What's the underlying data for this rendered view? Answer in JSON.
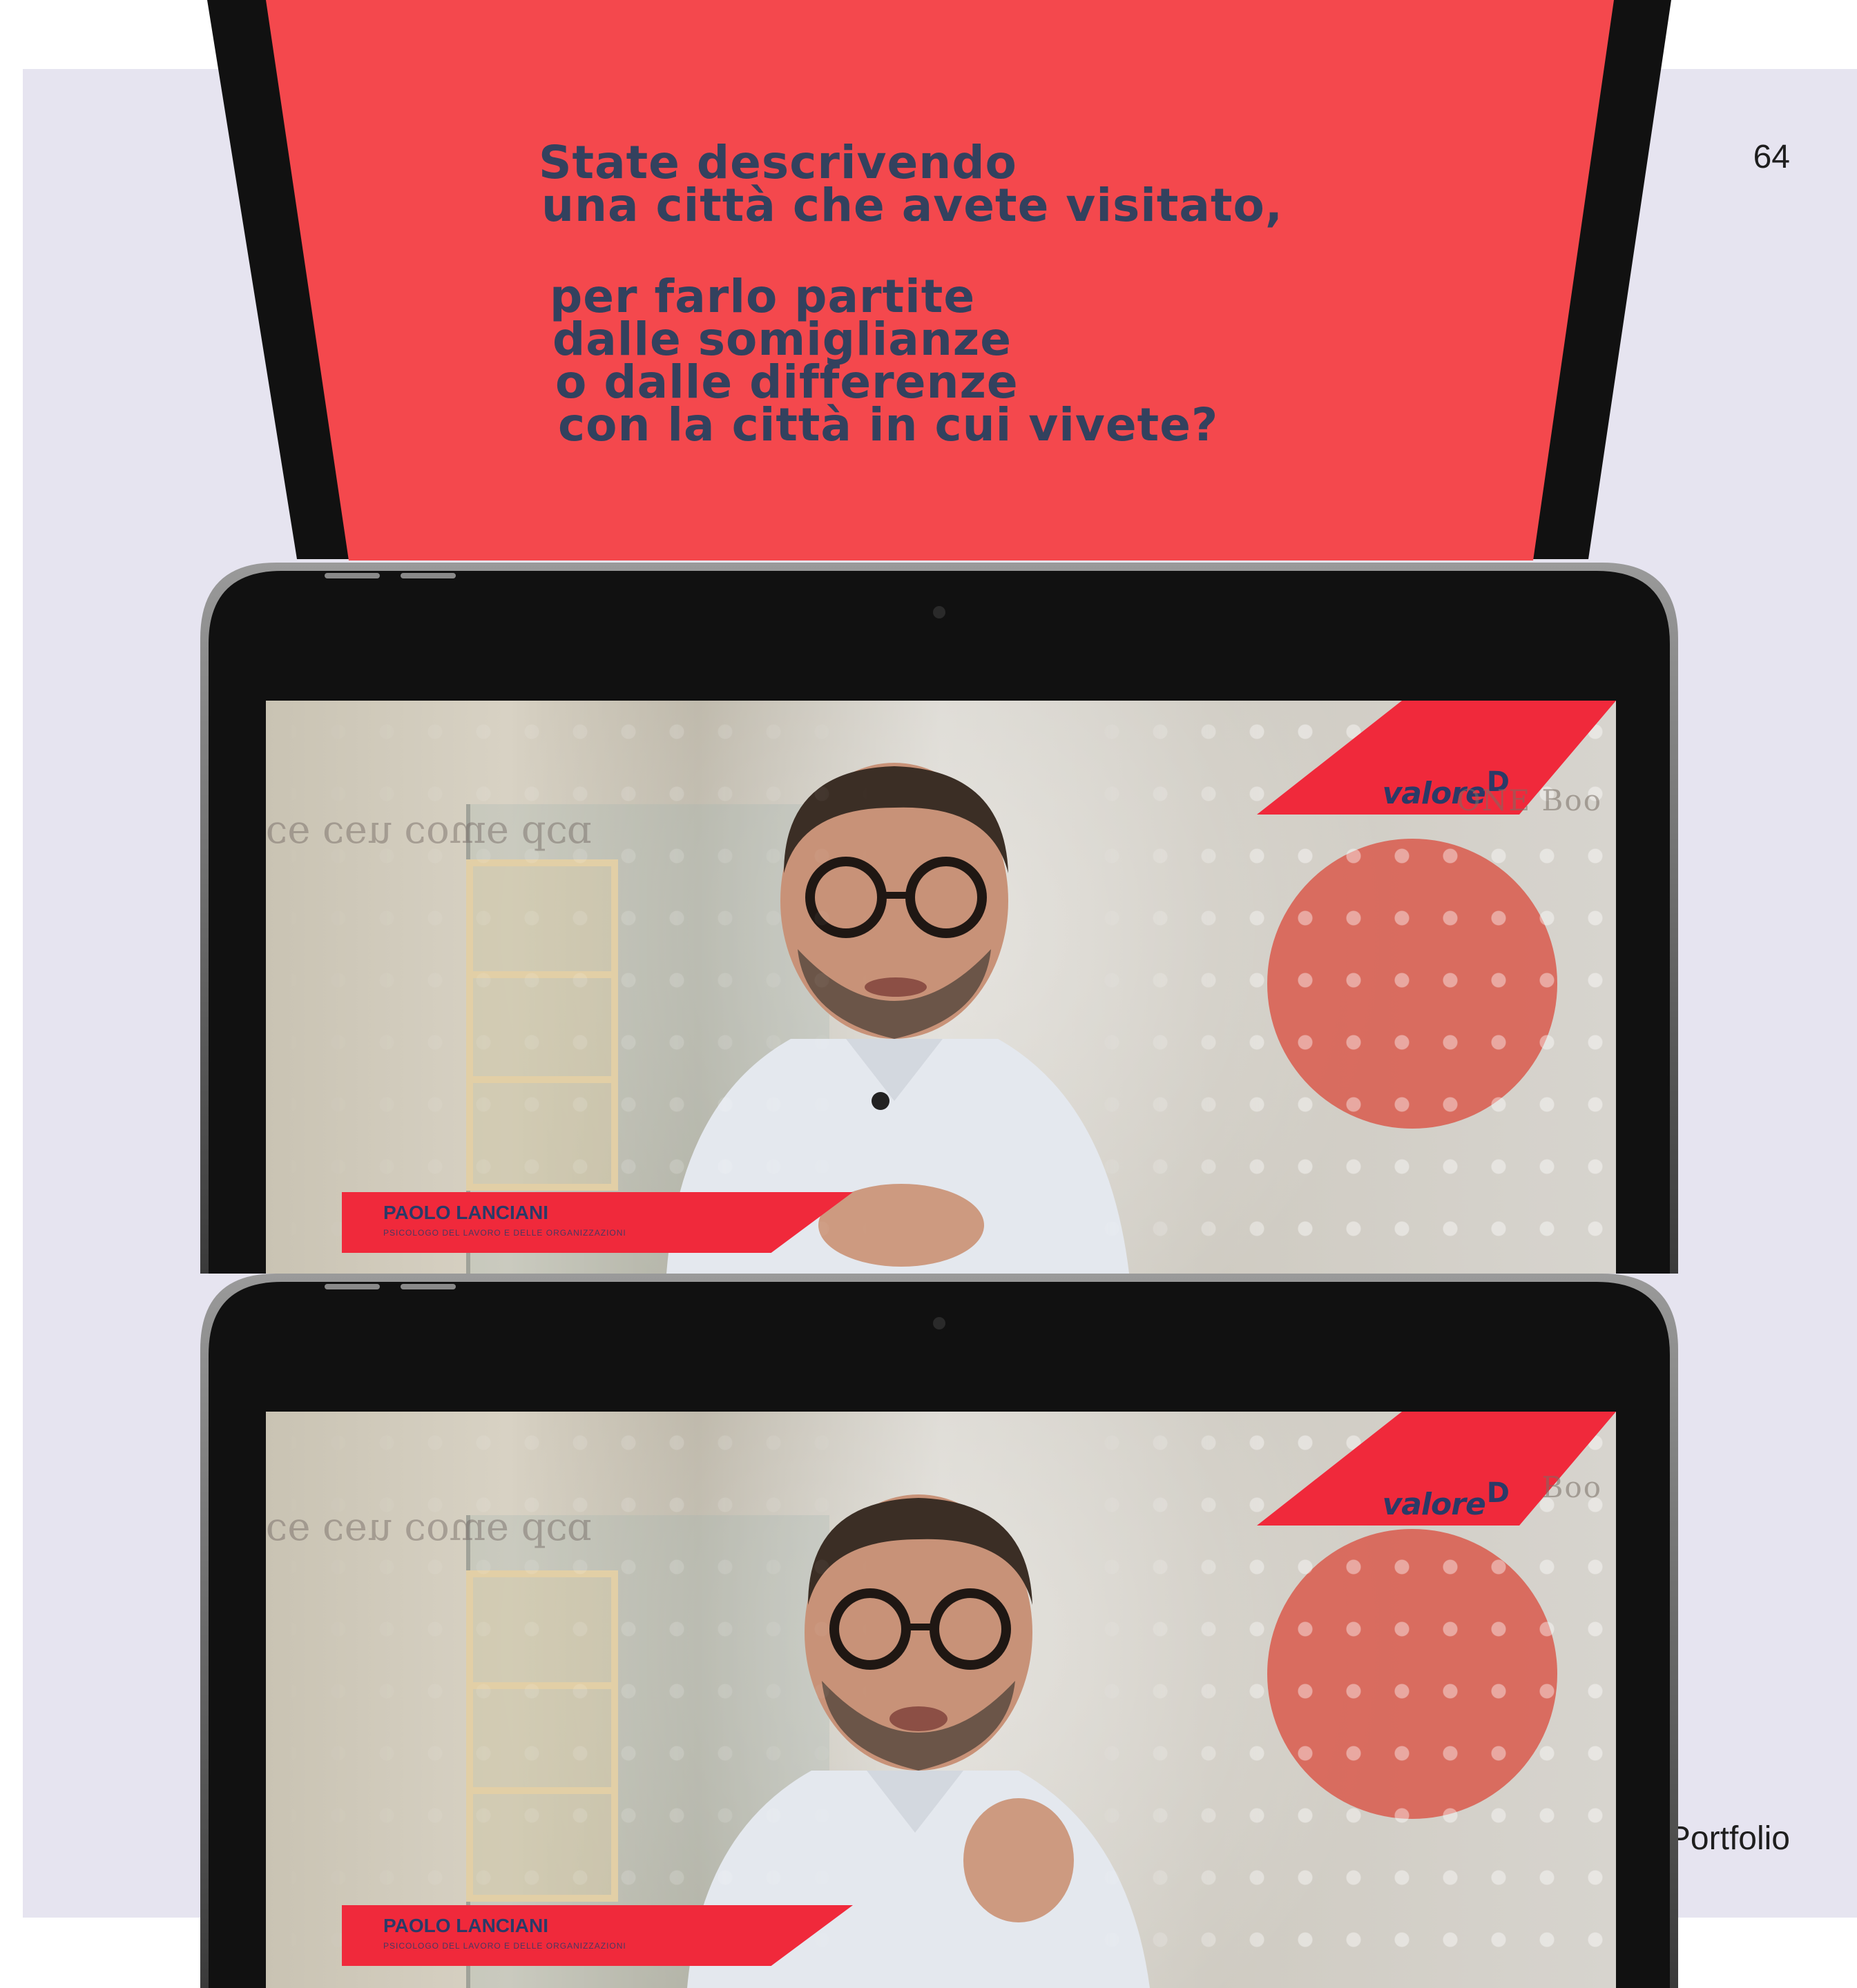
{
  "page": {
    "number": "64",
    "footer_label": "Portfolio"
  },
  "slide": {
    "lines_1": [
      "State descrivendo",
      "una città che avete visitato,"
    ],
    "lines_2": [
      "per farlo partite",
      "dalle somiglianze",
      "o dalle differenze",
      "con la città in cui vivete?"
    ],
    "background_color": "#f4484d",
    "text_color": "#33415e"
  },
  "videos": [
    {
      "brand": "valore",
      "brand_mark": "D",
      "speaker_name": "PAOLO LANCIANI",
      "speaker_role": "PSICOLOGO DEL LAVORO E DELLE ORGANIZZAZIONI",
      "background_sign": "ONE Boo"
    },
    {
      "brand": "valore",
      "brand_mark": "D",
      "speaker_name": "PAOLO LANCIANI",
      "speaker_role": "PSICOLOGO DEL LAVORO E DELLE ORGANIZZAZIONI",
      "background_sign": "Boo"
    }
  ],
  "colors": {
    "panel_background": "#e6e4f0",
    "brand_red": "#f0293b",
    "brand_navy": "#2b3a67",
    "device_frame": "#111111"
  }
}
